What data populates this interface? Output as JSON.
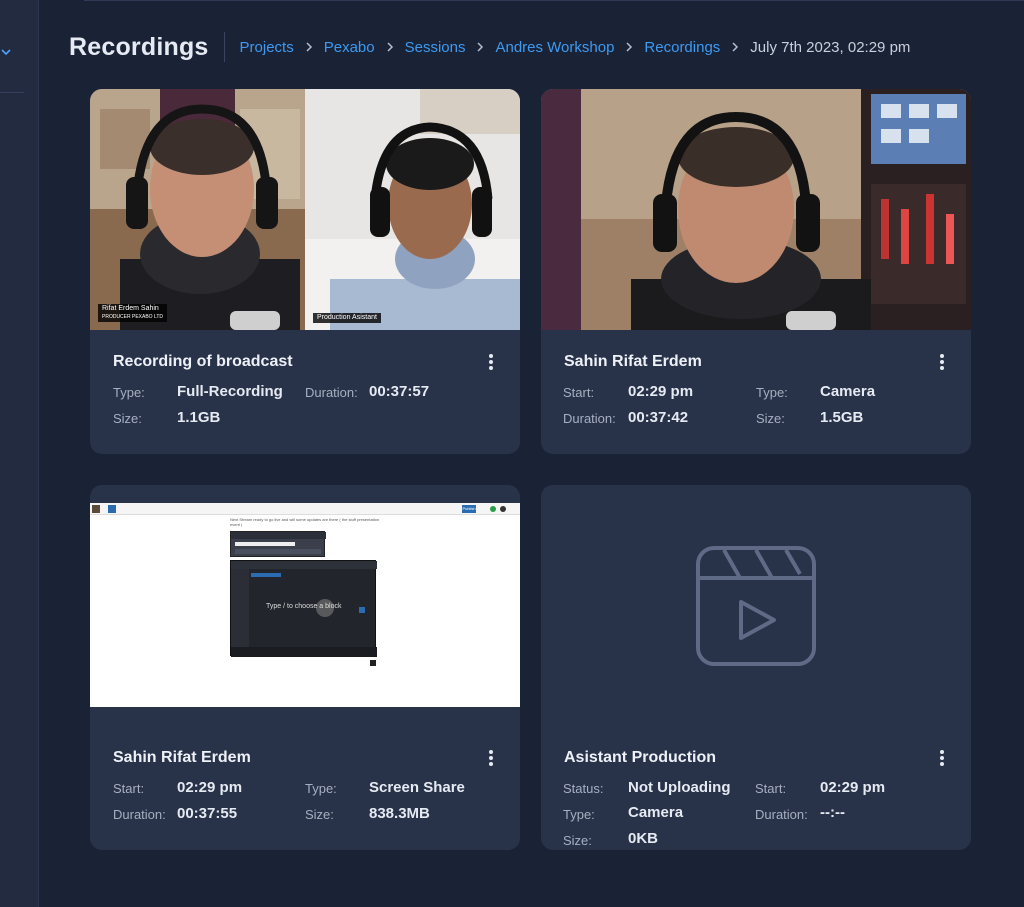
{
  "page": {
    "title": "Recordings",
    "breadcrumbs": [
      "Projects",
      "Pexabo",
      "Sessions",
      "Andres Workshop",
      "Recordings"
    ],
    "current": "July 7th 2023, 02:29 pm"
  },
  "cards": [
    {
      "title": "Recording of broadcast",
      "thumbnail": "video-call-two-people",
      "overlays": {
        "left_name": "Rifat Erdem Sahin",
        "left_company": "PRODUCER PEXABO LTD",
        "right_name": "Production Asistant"
      },
      "fields": [
        {
          "label": "Type:",
          "value": "Full-Recording"
        },
        {
          "label": "Duration:",
          "value": "00:37:57"
        },
        {
          "label": "Size:",
          "value": "1.1GB"
        }
      ]
    },
    {
      "title": "Sahin Rifat Erdem",
      "thumbnail": "camera-single-person",
      "fields": [
        {
          "label": "Start:",
          "value": "02:29 pm"
        },
        {
          "label": "Type:",
          "value": "Camera"
        },
        {
          "label": "Duration:",
          "value": "00:37:42"
        },
        {
          "label": "Size:",
          "value": "1.5GB"
        }
      ]
    },
    {
      "title": "Sahin Rifat Erdem",
      "thumbnail": "screen-share-document",
      "screen_text": {
        "intro": "Next Stream ready to go live and will some updates are there ( the stuff presentation event )",
        "prompt": "Type / to choose a block",
        "button": "Publish"
      },
      "fields": [
        {
          "label": "Start:",
          "value": "02:29 pm"
        },
        {
          "label": "Type:",
          "value": "Screen Share"
        },
        {
          "label": "Duration:",
          "value": "00:37:55"
        },
        {
          "label": "Size:",
          "value": "838.3MB"
        }
      ]
    },
    {
      "title": "Asistant Production",
      "thumbnail": "video-placeholder-icon",
      "fields": [
        {
          "label": "Status:",
          "value": "Not Uploading"
        },
        {
          "label": "Start:",
          "value": "02:29 pm"
        },
        {
          "label": "Type:",
          "value": "Camera"
        },
        {
          "label": "Duration:",
          "value": "--:--"
        },
        {
          "label": "Size:",
          "value": "0KB"
        }
      ]
    }
  ],
  "colors": {
    "background": "#1a2236",
    "card": "#283248",
    "link": "#3d9af2",
    "label": "#a7afc1",
    "value": "#e6eaf2"
  }
}
